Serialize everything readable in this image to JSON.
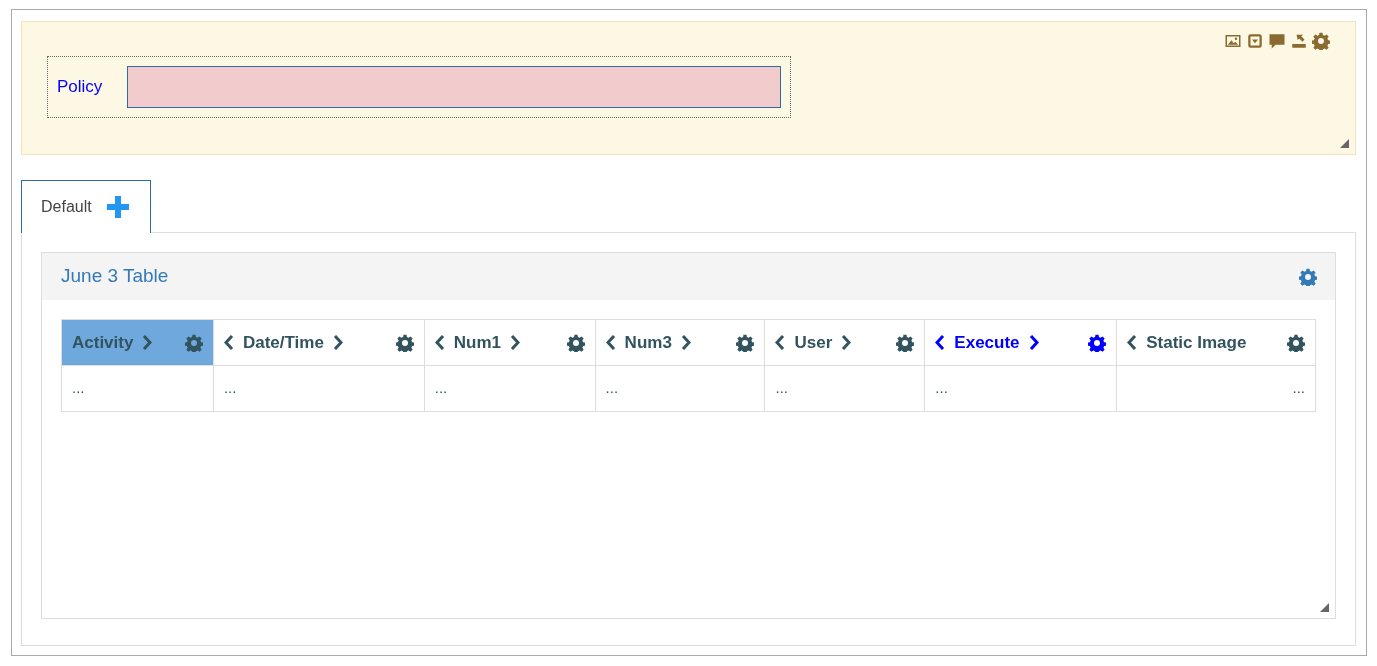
{
  "form": {
    "field": {
      "label": "Policy",
      "invalid": true
    }
  },
  "tabs": [
    {
      "label": "Default",
      "selected": true
    }
  ],
  "panel": {
    "title": "June 3 Table",
    "columns": [
      {
        "label": "Activity",
        "selected": true,
        "kind": "plain",
        "prev": false,
        "next": true
      },
      {
        "label": "Date/Time",
        "selected": false,
        "kind": "plain",
        "prev": true,
        "next": true
      },
      {
        "label": "Num1",
        "selected": false,
        "kind": "plain",
        "prev": true,
        "next": true
      },
      {
        "label": "Num3",
        "selected": false,
        "kind": "plain",
        "prev": true,
        "next": true
      },
      {
        "label": "User",
        "selected": false,
        "kind": "plain",
        "prev": true,
        "next": true
      },
      {
        "label": "Execute",
        "selected": false,
        "kind": "link",
        "prev": true,
        "next": true
      },
      {
        "label": "Static Image",
        "selected": false,
        "kind": "plain",
        "prev": true,
        "next": false
      }
    ],
    "rows": [
      [
        "...",
        "...",
        "...",
        "...",
        "...",
        "...",
        "..."
      ]
    ]
  }
}
